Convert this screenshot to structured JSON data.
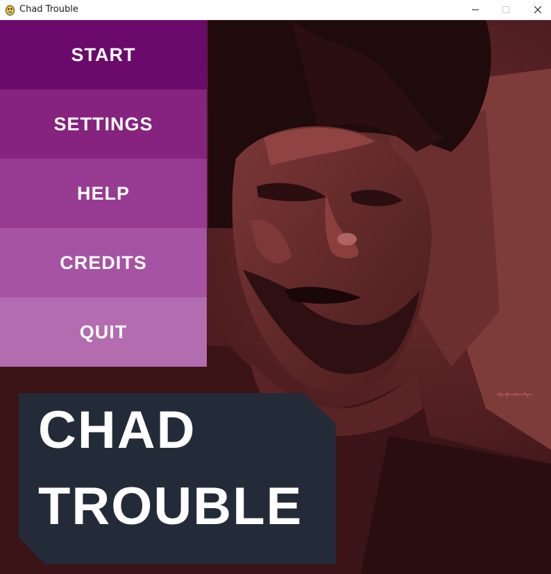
{
  "window": {
    "title": "Chad Trouble",
    "icon": "pygame-snake-icon",
    "controls": [
      "minimize-icon",
      "maximize-icon",
      "close-icon"
    ]
  },
  "menu": {
    "items": [
      {
        "label": "START",
        "color": "#6b0a6b"
      },
      {
        "label": "SETTINGS",
        "color": "#85237f"
      },
      {
        "label": "HELP",
        "color": "#963b91"
      },
      {
        "label": "CREDITS",
        "color": "#a653a3"
      },
      {
        "label": "QUIT",
        "color": "#b36cb0"
      }
    ]
  },
  "game_title": {
    "line1": "CHAD",
    "line2": "TROUBLE"
  },
  "background": {
    "description_icon": "portrait-artwork",
    "base_color": "#4a1a1e",
    "accent_color": "#8a3a3a"
  }
}
